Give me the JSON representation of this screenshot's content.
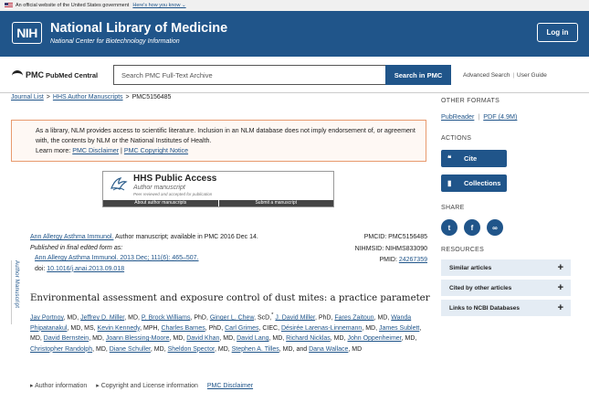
{
  "gov_banner": {
    "text": "An official website of the United States government",
    "link": "Here's how you know"
  },
  "header": {
    "nih_logo": "NIH",
    "title": "National Library of Medicine",
    "subtitle": "National Center for Biotechnology Information",
    "login": "Log in"
  },
  "pmc": {
    "logo_pmc": "PMC",
    "logo_name": "PubMed Central",
    "search_placeholder": "Search PMC Full-Text Archive",
    "search_button": "Search in PMC",
    "advanced": "Advanced Search",
    "guide": "User Guide"
  },
  "breadcrumb": {
    "journal_list": "Journal List",
    "hhs": "HHS Author Manuscripts",
    "current": "PMC5156485"
  },
  "notice": {
    "text": "As a library, NLM provides access to scientific literature. Inclusion in an NLM database does not imply endorsement of, or agreement with, the contents by NLM or the National Institutes of Health.",
    "learn_more": "Learn more:",
    "disclaimer": "PMC Disclaimer",
    "copyright": "PMC Copyright Notice"
  },
  "hhs_banner": {
    "title": "HHS Public Access",
    "subtitle": "Author manuscript",
    "subtitle2": "Peer reviewed and accepted for publication",
    "about": "About author manuscripts",
    "submit": "Submit a manuscript"
  },
  "side_label": "Author Manuscript",
  "citation": {
    "journal": "Ann Allergy Asthma Immunol.",
    "line1_rest": "Author manuscript; available in PMC 2016 Dec 14.",
    "published": "Published in final edited form as:",
    "final_ref": "Ann Allergy Asthma Immunol. 2013 Dec; 111(6): 465–507.",
    "doi_label": "doi:",
    "doi": "10.1016/j.anai.2013.09.018",
    "pmcid": "PMCID: PMC5156485",
    "nihmsid": "NIHMSID: NIHMS833090",
    "pmid_label": "PMID:",
    "pmid": "24267359"
  },
  "article_title": "Environmental assessment and exposure control of dust mites: a practice parameter",
  "bottom_links": {
    "author_info": "Author information",
    "copyright": "Copyright and License information",
    "disclaimer": "PMC Disclaimer"
  },
  "sidebar": {
    "other_formats": "OTHER FORMATS",
    "pubreader": "PubReader",
    "pdf": "PDF (4.9M)",
    "actions": "ACTIONS",
    "cite": "Cite",
    "collections": "Collections",
    "share": "SHARE",
    "resources": "RESOURCES",
    "resource_items": [
      "Similar articles",
      "Cited by other articles",
      "Links to NCBI Databases"
    ]
  }
}
